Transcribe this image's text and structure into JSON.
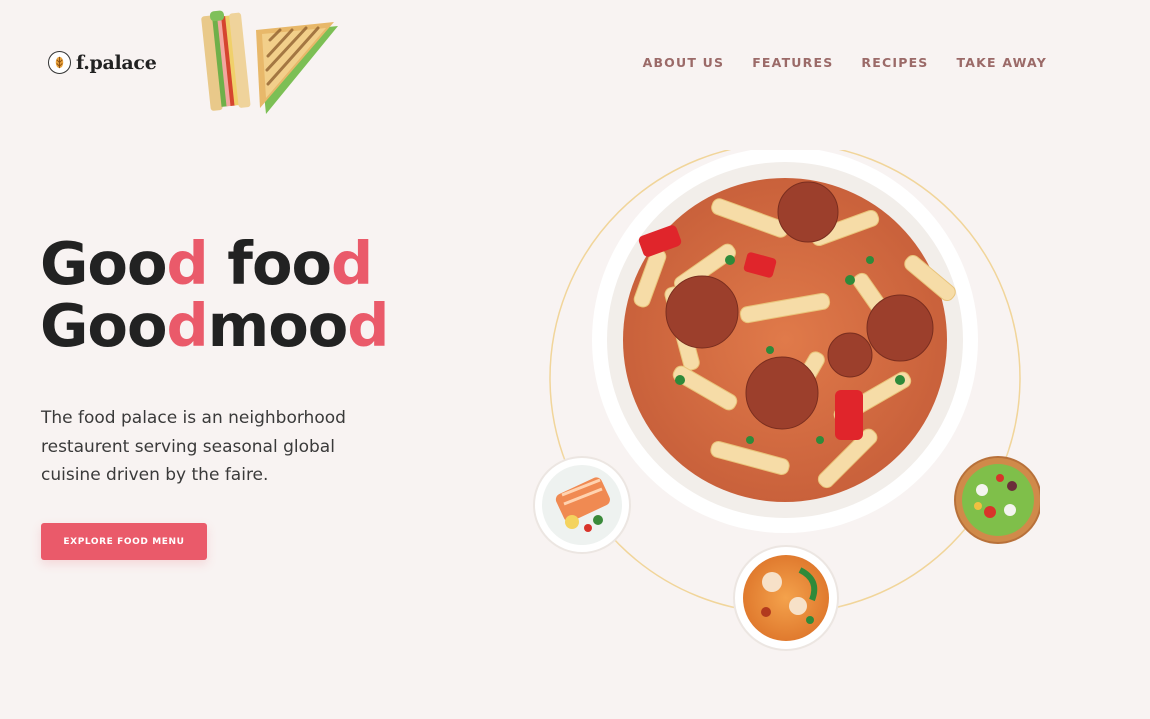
{
  "header": {
    "logo_text": "f.palace",
    "nav": [
      {
        "label": "ABOUT US"
      },
      {
        "label": "FEATURES"
      },
      {
        "label": "RECIPES"
      },
      {
        "label": "TAKE AWAY"
      }
    ]
  },
  "hero": {
    "headline_line1": {
      "a": "Goo",
      "b": "d",
      "c": " foo",
      "d": "d"
    },
    "headline_line2": {
      "a": "Goo",
      "b": "d",
      "c": "moo",
      "d": "d"
    },
    "description": "The food palace is an neighborhood restaurent serving seasonal global cuisine driven by the faire.",
    "cta_label": "EXPLORE FOOD MENU"
  },
  "colors": {
    "background": "#f8f3f2",
    "accent": "#ea5a6a",
    "nav_text": "#9b6a68",
    "orbit": "#f1d59a"
  },
  "icons": {
    "logo": "wheat-emblem-icon"
  }
}
